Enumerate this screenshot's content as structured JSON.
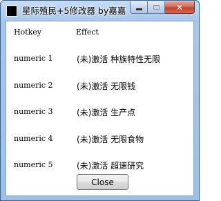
{
  "window": {
    "title": "星际殖民+5修改器 by嘉嘉",
    "icon": "app-icon",
    "caption_buttons": {
      "minimize": "minimize-icon",
      "maximize": "maximize-icon",
      "close": "✕"
    }
  },
  "table": {
    "header": {
      "hotkey": "Hotkey",
      "effect": "Effect"
    },
    "rows": [
      {
        "hotkey": "numeric 1",
        "effect": "(未)激活 种族特性无限"
      },
      {
        "hotkey": "numeric 2",
        "effect": "(未)激活 无限钱"
      },
      {
        "hotkey": "numeric 3",
        "effect": "(未)激活 生产点"
      },
      {
        "hotkey": "numeric 4",
        "effect": "(未)激活 无限食物"
      },
      {
        "hotkey": "numeric 5",
        "effect": "(未)激活 超速研究"
      }
    ]
  },
  "buttons": {
    "close": "Close"
  }
}
